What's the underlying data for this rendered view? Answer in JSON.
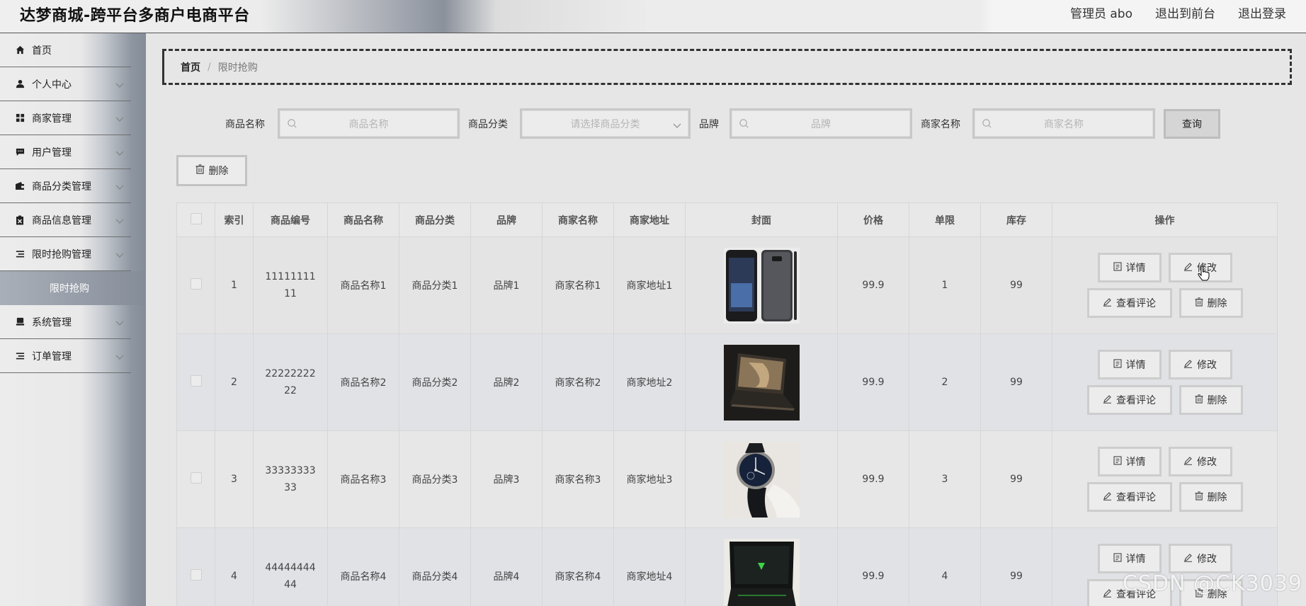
{
  "header": {
    "title": "达梦商城-跨平台多商户电商平台",
    "admin_label": "管理员 abo",
    "front_label": "退出到前台",
    "logout_label": "退出登录"
  },
  "sidebar": {
    "items": [
      {
        "label": "首页",
        "icon": "home-icon",
        "has_arrow": false
      },
      {
        "label": "个人中心",
        "icon": "user-icon",
        "has_arrow": true
      },
      {
        "label": "商家管理",
        "icon": "grid-icon",
        "has_arrow": true
      },
      {
        "label": "用户管理",
        "icon": "chat-icon",
        "has_arrow": true
      },
      {
        "label": "商品分类管理",
        "icon": "wallet-icon",
        "has_arrow": true
      },
      {
        "label": "商品信息管理",
        "icon": "clipboard-icon",
        "has_arrow": true
      },
      {
        "label": "限时抢购管理",
        "icon": "list-icon",
        "has_arrow": true
      },
      {
        "label": "系统管理",
        "icon": "store-icon",
        "has_arrow": true
      },
      {
        "label": "订单管理",
        "icon": "list-icon",
        "has_arrow": true
      }
    ],
    "active_sub": "限时抢购"
  },
  "breadcrumb": {
    "home": "首页",
    "separator": "/",
    "current": "限时抢购"
  },
  "search": {
    "name_label": "商品名称",
    "name_placeholder": "商品名称",
    "category_label": "商品分类",
    "category_placeholder": "请选择商品分类",
    "brand_label": "品牌",
    "brand_placeholder": "品牌",
    "merchant_label": "商家名称",
    "merchant_placeholder": "商家名称",
    "query_label": "查询"
  },
  "toolbar": {
    "delete_label": "删除"
  },
  "table": {
    "columns": [
      "索引",
      "商品编号",
      "商品名称",
      "商品分类",
      "品牌",
      "商家名称",
      "商家地址",
      "封面",
      "价格",
      "单限",
      "库存",
      "操作"
    ],
    "rows": [
      {
        "index": "1",
        "code": "1111111111",
        "name": "商品名称1",
        "category": "商品分类1",
        "brand": "品牌1",
        "merchant": "商家名称1",
        "address": "商家地址1",
        "cover": "phone",
        "price": "99.9",
        "limit": "1",
        "stock": "99"
      },
      {
        "index": "2",
        "code": "2222222222",
        "name": "商品名称2",
        "category": "商品分类2",
        "brand": "品牌2",
        "merchant": "商家名称2",
        "address": "商家地址2",
        "cover": "laptop",
        "price": "99.9",
        "limit": "2",
        "stock": "99"
      },
      {
        "index": "3",
        "code": "3333333333",
        "name": "商品名称3",
        "category": "商品分类3",
        "brand": "品牌3",
        "merchant": "商家名称3",
        "address": "商家地址3",
        "cover": "watch",
        "price": "99.9",
        "limit": "3",
        "stock": "99"
      },
      {
        "index": "4",
        "code": "4444444444",
        "name": "商品名称4",
        "category": "商品分类4",
        "brand": "品牌4",
        "merchant": "商家名称4",
        "address": "商家地址4",
        "cover": "gaming-laptop",
        "price": "99.9",
        "limit": "4",
        "stock": "99"
      }
    ],
    "actions": {
      "detail": "详情",
      "edit": "修改",
      "reviews": "查看评论",
      "delete": "删除"
    }
  },
  "watermark": "CSDN @CK3039"
}
